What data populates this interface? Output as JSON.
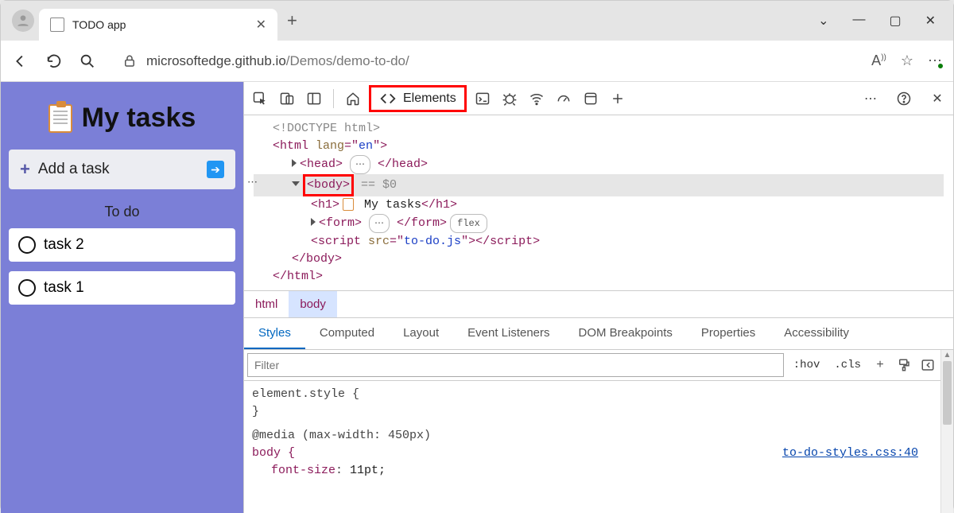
{
  "browser": {
    "tab": {
      "title": "TODO app"
    },
    "url_host": "microsoftedge.github.io",
    "url_path": "/Demos/demo-to-do/"
  },
  "page": {
    "heading": "My tasks",
    "add_label": "Add a task",
    "section": "To do",
    "tasks": [
      "task 2",
      "task 1"
    ]
  },
  "devtools": {
    "elements_tab": "Elements",
    "dom": {
      "doctype": "<!DOCTYPE html>",
      "html_open": "<html lang=\"en\">",
      "head": "<head>",
      "head_close": "</head>",
      "body": "<body>",
      "eq0": " == $0",
      "h1_open": "<h1>",
      "h1_text": " My tasks",
      "h1_close": "</h1>",
      "form": "<form>",
      "form_close": "</form>",
      "form_pill": "flex",
      "script_open": "<script src=\"to-do.js\">",
      "script_close": "</script>",
      "body_close": "</body>",
      "html_close": "</html>"
    },
    "crumbs": [
      "html",
      "body"
    ],
    "subtabs": [
      "Styles",
      "Computed",
      "Layout",
      "Event Listeners",
      "DOM Breakpoints",
      "Properties",
      "Accessibility"
    ],
    "filter_placeholder": "Filter",
    "hov": ":hov",
    "cls": ".cls",
    "css": {
      "elstyle": "element.style {",
      "close": "}",
      "media": "@media (max-width: 450px)",
      "body_open": "body {",
      "prop1_n": "font-size",
      "prop1_v": "11pt;",
      "link": "to-do-styles.css:40"
    }
  }
}
